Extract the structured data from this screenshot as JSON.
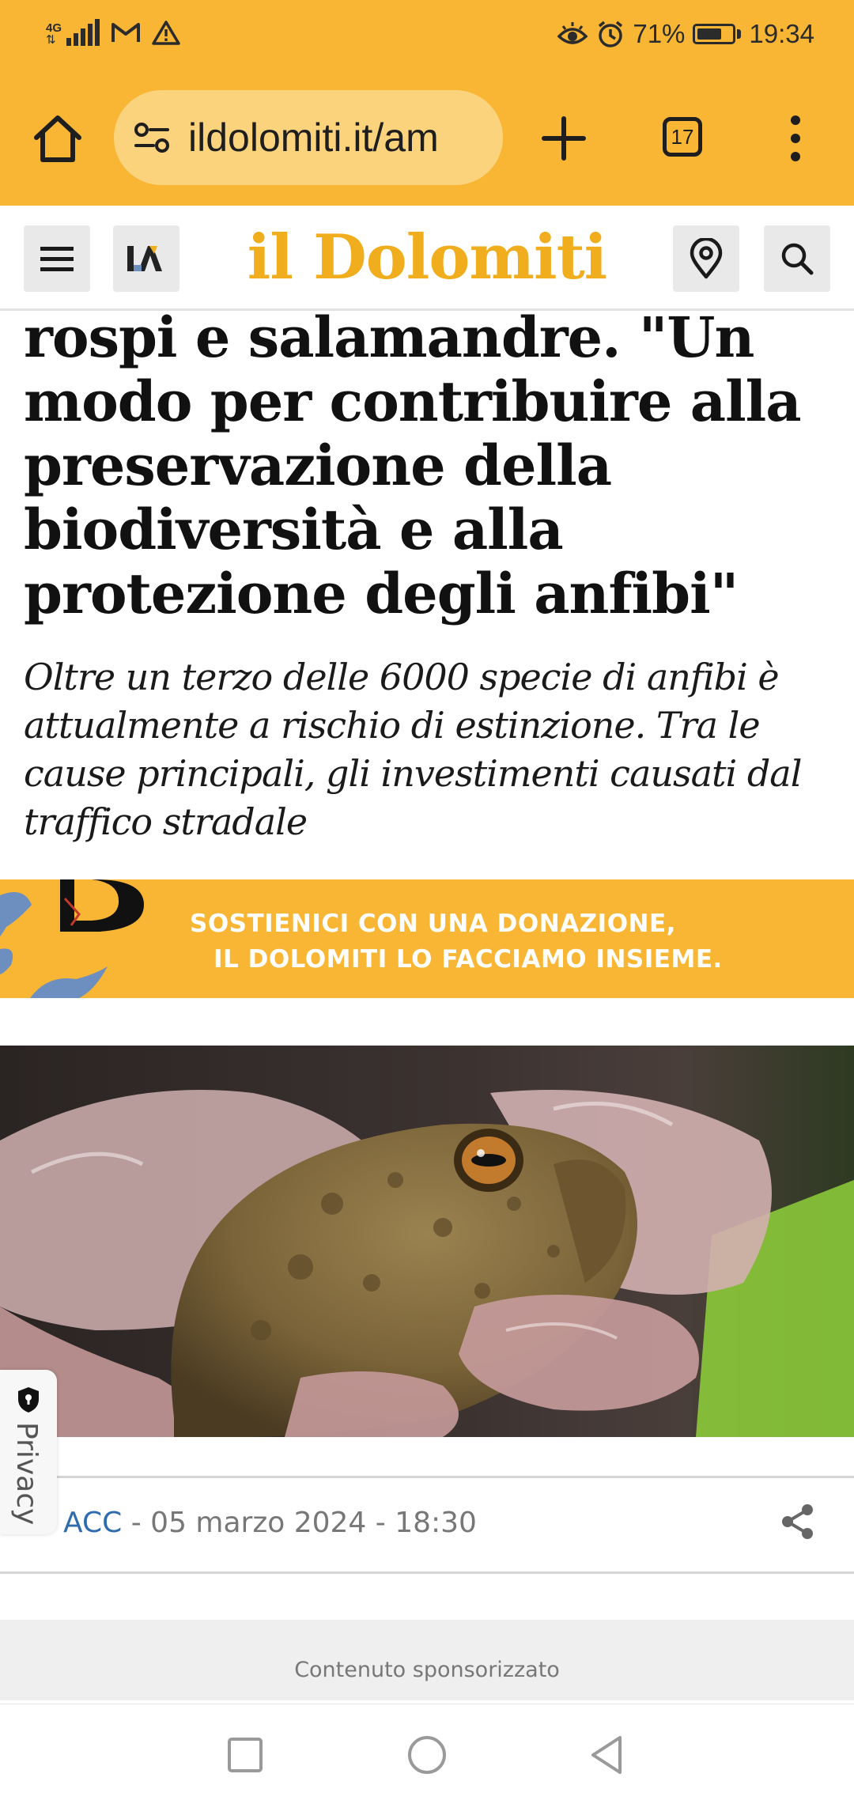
{
  "status_bar": {
    "network_label": "4G",
    "battery_percent": "71%",
    "battery_level": 0.71,
    "time": "19:34",
    "icons": [
      "signal-icon",
      "gmail-icon",
      "warning-icon",
      "eye-comfort-icon",
      "alarm-icon",
      "battery-icon"
    ]
  },
  "browser": {
    "url": "ildolomiti.it/am",
    "tab_count": "17",
    "icons": [
      "home-icon",
      "site-settings-icon",
      "new-tab-plus-icon",
      "tab-switcher-icon",
      "overflow-menu-icon"
    ]
  },
  "site_header": {
    "logo_text": "il Dolomiti",
    "brand_color": "#f0ae1f",
    "icons": [
      "hamburger-menu-icon",
      "site-mark-icon",
      "location-pin-icon",
      "search-icon"
    ]
  },
  "article": {
    "headline": "rospi e salamandre. \"Un modo per contribuire alla preservazione della biodiversità e alla protezione degli anfibi\"",
    "subtitle": "Oltre un terzo delle 6000 specie di anfibi è attualmente a rischio di estinzione. Tra le cause principali, gli investimenti causati dal traffico stradale",
    "author": "ACC",
    "date_sep": " - ",
    "date": "05 marzo 2024 - 18:30"
  },
  "banner": {
    "line1": "SOSTIENICI CON UNA DONAZIONE,",
    "line2": "IL DOLOMITI LO FACCIAMO INSIEME.",
    "logo_letter": "D",
    "color": "#f8b634"
  },
  "privacy": {
    "label": "Privacy"
  },
  "sponsored": {
    "label": "Contenuto sponsorizzato"
  },
  "nav_bar": {
    "icons": [
      "recents-square-icon",
      "home-circle-icon",
      "back-triangle-icon"
    ]
  }
}
